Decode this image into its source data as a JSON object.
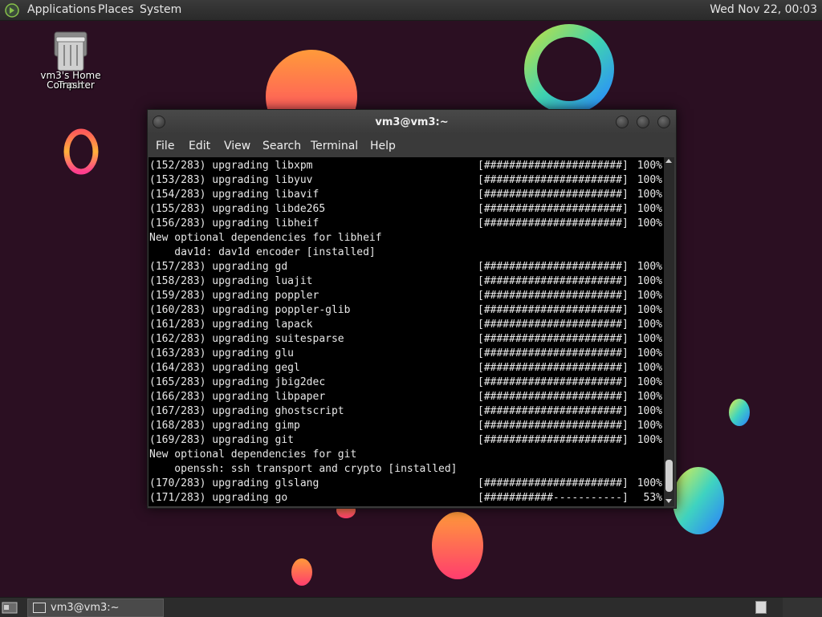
{
  "top_panel": {
    "menus": [
      "Applications",
      "Places",
      "System"
    ],
    "clock": "Wed Nov 22, 00:03"
  },
  "desktop": {
    "icons": [
      {
        "label": "vm3's Home",
        "icon": "home-folder-icon"
      },
      {
        "label": "Computer",
        "icon": "computer-icon"
      },
      {
        "label": "Trash",
        "icon": "trash-icon"
      }
    ]
  },
  "terminal": {
    "title": "vm3@vm3:~",
    "menu": [
      "File",
      "Edit",
      "View",
      "Search",
      "Terminal",
      "Help"
    ],
    "lines": [
      {
        "text": "(152/283) upgrading libxpm",
        "bar": "[######################]",
        "pct": "100%"
      },
      {
        "text": "(153/283) upgrading libyuv",
        "bar": "[######################]",
        "pct": "100%"
      },
      {
        "text": "(154/283) upgrading libavif",
        "bar": "[######################]",
        "pct": "100%"
      },
      {
        "text": "(155/283) upgrading libde265",
        "bar": "[######################]",
        "pct": "100%"
      },
      {
        "text": "(156/283) upgrading libheif",
        "bar": "[######################]",
        "pct": "100%"
      },
      {
        "text": "New optional dependencies for libheif",
        "bar": "",
        "pct": ""
      },
      {
        "text": "    dav1d: dav1d encoder [installed]",
        "bar": "",
        "pct": ""
      },
      {
        "text": "(157/283) upgrading gd",
        "bar": "[######################]",
        "pct": "100%"
      },
      {
        "text": "(158/283) upgrading luajit",
        "bar": "[######################]",
        "pct": "100%"
      },
      {
        "text": "(159/283) upgrading poppler",
        "bar": "[######################]",
        "pct": "100%"
      },
      {
        "text": "(160/283) upgrading poppler-glib",
        "bar": "[######################]",
        "pct": "100%"
      },
      {
        "text": "(161/283) upgrading lapack",
        "bar": "[######################]",
        "pct": "100%"
      },
      {
        "text": "(162/283) upgrading suitesparse",
        "bar": "[######################]",
        "pct": "100%"
      },
      {
        "text": "(163/283) upgrading glu",
        "bar": "[######################]",
        "pct": "100%"
      },
      {
        "text": "(164/283) upgrading gegl",
        "bar": "[######################]",
        "pct": "100%"
      },
      {
        "text": "(165/283) upgrading jbig2dec",
        "bar": "[######################]",
        "pct": "100%"
      },
      {
        "text": "(166/283) upgrading libpaper",
        "bar": "[######################]",
        "pct": "100%"
      },
      {
        "text": "(167/283) upgrading ghostscript",
        "bar": "[######################]",
        "pct": "100%"
      },
      {
        "text": "(168/283) upgrading gimp",
        "bar": "[######################]",
        "pct": "100%"
      },
      {
        "text": "(169/283) upgrading git",
        "bar": "[######################]",
        "pct": "100%"
      },
      {
        "text": "New optional dependencies for git",
        "bar": "",
        "pct": ""
      },
      {
        "text": "    openssh: ssh transport and crypto [installed]",
        "bar": "",
        "pct": ""
      },
      {
        "text": "(170/283) upgrading glslang",
        "bar": "[######################]",
        "pct": "100%"
      },
      {
        "text": "(171/283) upgrading go",
        "bar": "[###########-----------]",
        "pct": "53%"
      }
    ]
  },
  "taskbar": {
    "tasks": [
      {
        "label": "vm3@vm3:~",
        "icon": "terminal-icon"
      }
    ]
  },
  "colors": {
    "wallpaper": "#2b0f22",
    "panel": "#2c2c2c",
    "terminal_bg": "#000000",
    "terminal_fg": "#e8e8e8"
  }
}
